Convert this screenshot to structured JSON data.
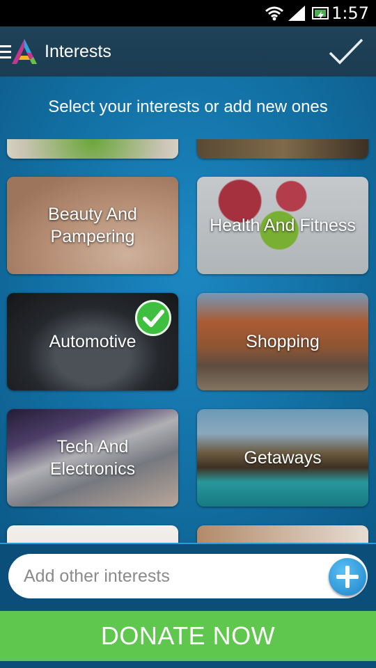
{
  "status_bar": {
    "time": "1:57"
  },
  "app_bar": {
    "title": "Interests"
  },
  "content": {
    "subtitle": "Select your interests or add new ones",
    "tiles": [
      {
        "label": "",
        "selected": false
      },
      {
        "label": "",
        "selected": false
      },
      {
        "label": "Beauty And Pampering",
        "selected": false
      },
      {
        "label": "Health And Fitness",
        "selected": false
      },
      {
        "label": "Automotive",
        "selected": true
      },
      {
        "label": "Shopping",
        "selected": false
      },
      {
        "label": "Tech And Electronics",
        "selected": false
      },
      {
        "label": "Getaways",
        "selected": false
      },
      {
        "label": "",
        "selected": false
      },
      {
        "label": "",
        "selected": false
      }
    ]
  },
  "input_bar": {
    "placeholder": "Add other interests",
    "value": ""
  },
  "donate": {
    "label": "DONATE NOW"
  },
  "colors": {
    "appbar": "#1f4258",
    "accent": "#1d87c2",
    "donate": "#5fc74d",
    "selected": "#3fbf3f"
  },
  "icons": [
    "wifi-icon",
    "signal-icon",
    "battery-icon",
    "menu-icon",
    "app-logo-icon",
    "check-icon",
    "checkmark-badge-icon",
    "plus-icon"
  ]
}
